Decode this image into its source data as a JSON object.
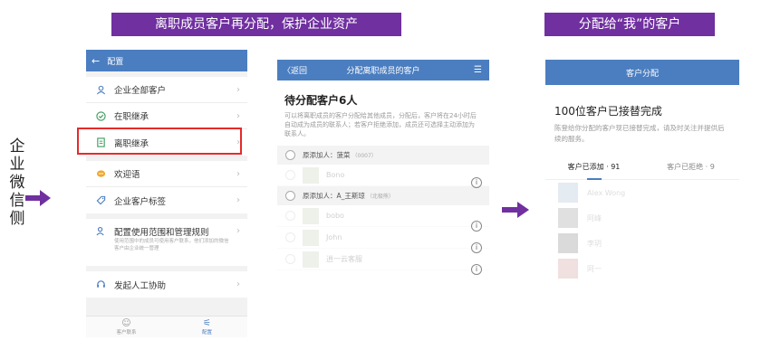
{
  "banners": {
    "left": "离职成员客户再分配，保护企业资产",
    "right": "分配给“我”的客户"
  },
  "side_label": "企业微信侧",
  "phone1": {
    "header_title": "配置",
    "menu_group1": [
      {
        "label": "企业全部客户"
      },
      {
        "label": "在职继承"
      },
      {
        "label": "离职继承"
      }
    ],
    "menu_group2": [
      {
        "label": "欢迎语"
      },
      {
        "label": "企业客户标签"
      }
    ],
    "menu_group3": {
      "label": "配置使用范围和管理规则",
      "sub": "使用范围中的成员可使用客户联系，他们添加的微信客户由企业统一管理"
    },
    "menu_group4": {
      "label": "发起人工协助"
    },
    "bottom_tabs": [
      {
        "label": "客户联系"
      },
      {
        "label": "配置"
      }
    ]
  },
  "phone2": {
    "back_label": "〈返回",
    "header_title": "分配离职成员的客户",
    "title": "待分配客户6人",
    "desc": "可以将离职成员的客户分配给其他成员，分配后，客户将在24小时后自动成为成员的联系人；若客户拒绝添加，成员还可选择主动添加为联系人。",
    "groups": [
      {
        "head": "原添加人：菠菜",
        "note": "（0007）",
        "customers": [
          "Bono"
        ]
      },
      {
        "head": "原添加人：A_王斯琼",
        "note": "（北极熊）",
        "customers": [
          "bobo",
          "John",
          "逍一云客服"
        ]
      }
    ]
  },
  "phone3": {
    "header_title": "客户分配",
    "title": "100位客户已接替完成",
    "desc": "陈登给你分配的客户现已接替完成，请及时关注并提供后续的服务。",
    "tabs": [
      "客户已添加 · 91",
      "客户已拒绝 · 9"
    ],
    "customers": [
      "Alex Wong",
      "阿峰",
      "李玥",
      "阿一"
    ]
  },
  "colors": {
    "banner": "#7030a0",
    "header": "#4b7ec0",
    "highlight": "#e52a2a"
  }
}
